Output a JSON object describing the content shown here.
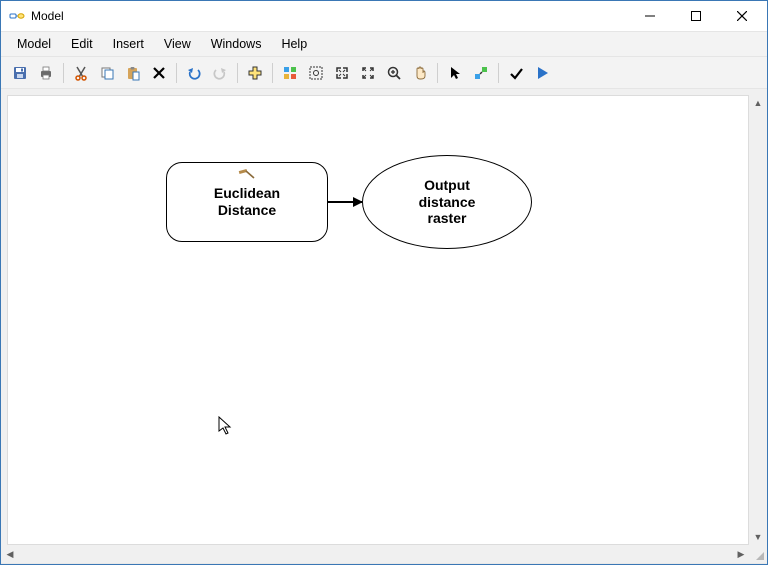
{
  "window": {
    "title": "Model"
  },
  "menu": {
    "model": "Model",
    "edit": "Edit",
    "insert": "Insert",
    "view": "View",
    "windows": "Windows",
    "help": "Help"
  },
  "toolbar": {
    "save": "save-icon",
    "print": "print-icon",
    "cut": "cut-icon",
    "copy": "copy-icon",
    "paste": "paste-icon",
    "delete": "delete-icon",
    "undo": "undo-icon",
    "redo": "redo-icon",
    "add_data": "add-data-icon",
    "auto_layout": "auto-layout-icon",
    "full_extent": "full-extent-icon",
    "zoom_in_fixed": "zoom-in-group-icon",
    "zoom_out_fixed": "zoom-out-group-icon",
    "zoom_tool": "zoom-icon",
    "pan": "pan-icon",
    "select": "select-icon",
    "connect": "connect-icon",
    "validate": "validate-icon",
    "run": "run-icon"
  },
  "diagram": {
    "tool_node": {
      "line1": "Euclidean",
      "line2": "Distance",
      "has_hammer": true
    },
    "output_node": {
      "line1": "Output",
      "line2": "distance",
      "line3": "raster"
    }
  }
}
